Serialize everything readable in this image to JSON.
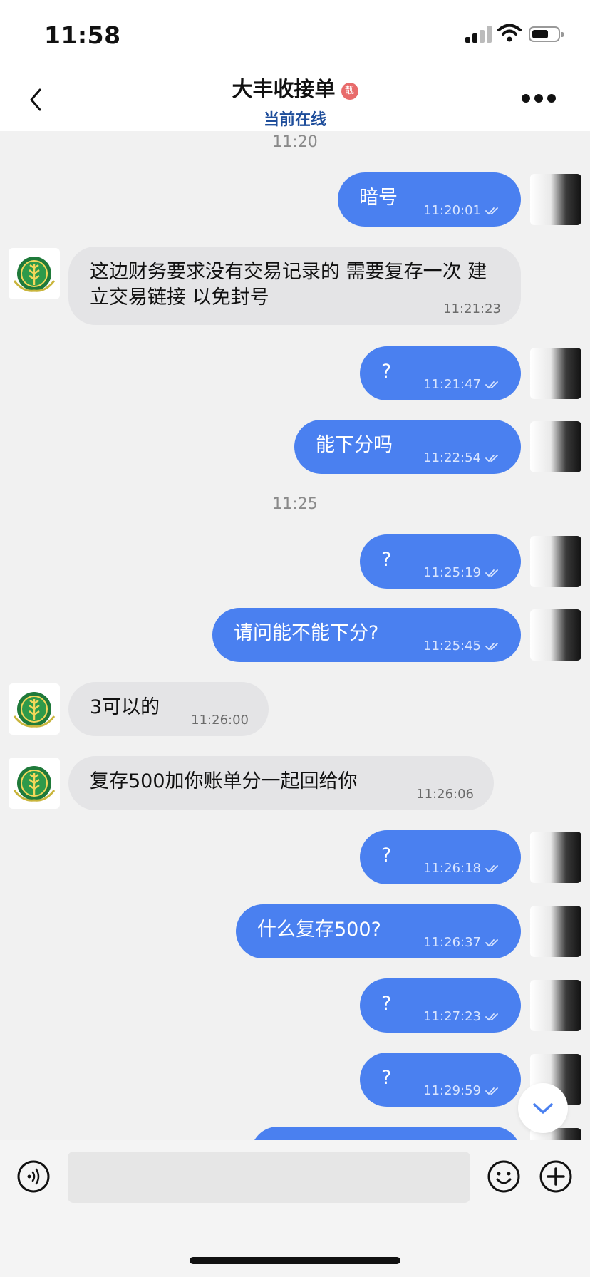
{
  "status_bar": {
    "time": "11:58",
    "battery_icon": "battery-icon",
    "wifi_icon": "wifi-icon",
    "signal_icon": "signal-icon"
  },
  "header": {
    "title": "大丰收接单",
    "badge": "靓",
    "subtitle": "当前在线",
    "back_icon": "chevron-left-icon",
    "more_icon": "more-horizontal-icon"
  },
  "messages": [
    {
      "type": "stamp",
      "text": "11:20"
    },
    {
      "type": "out",
      "text": "暗号",
      "time": "11:20:01"
    },
    {
      "type": "in",
      "text": "这边财务要求没有交易记录的  需要复存一次   建立交易链接   以免封号",
      "time": "11:21:23"
    },
    {
      "type": "out",
      "text": "?",
      "time": "11:21:47"
    },
    {
      "type": "out",
      "text": "能下分吗",
      "time": "11:22:54"
    },
    {
      "type": "stamp",
      "text": "11:25"
    },
    {
      "type": "out",
      "text": "?",
      "time": "11:25:19"
    },
    {
      "type": "out",
      "text": "请问能不能下分?",
      "time": "11:25:45"
    },
    {
      "type": "in",
      "text": "3可以的",
      "time": "11:26:00"
    },
    {
      "type": "in",
      "text": "复存500加你账单分一起回给你",
      "time": "11:26:06"
    },
    {
      "type": "out",
      "text": "?",
      "time": "11:26:18"
    },
    {
      "type": "out",
      "text": "什么复存500?",
      "time": "11:26:37"
    },
    {
      "type": "out",
      "text": "?",
      "time": "11:27:23"
    },
    {
      "type": "out",
      "text": "?",
      "time": "11:29:59"
    }
  ],
  "input": {
    "placeholder": "",
    "voice_icon": "voice-icon",
    "emoji_icon": "emoji-icon",
    "plus_icon": "plus-circle-icon"
  },
  "scroll_icon": "chevron-down-icon",
  "colors": {
    "outgoing_bubble": "#4a80f0",
    "incoming_bubble": "#e4e4e6",
    "subtitle": "#1f4e9b",
    "background": "#f1f1f1"
  }
}
